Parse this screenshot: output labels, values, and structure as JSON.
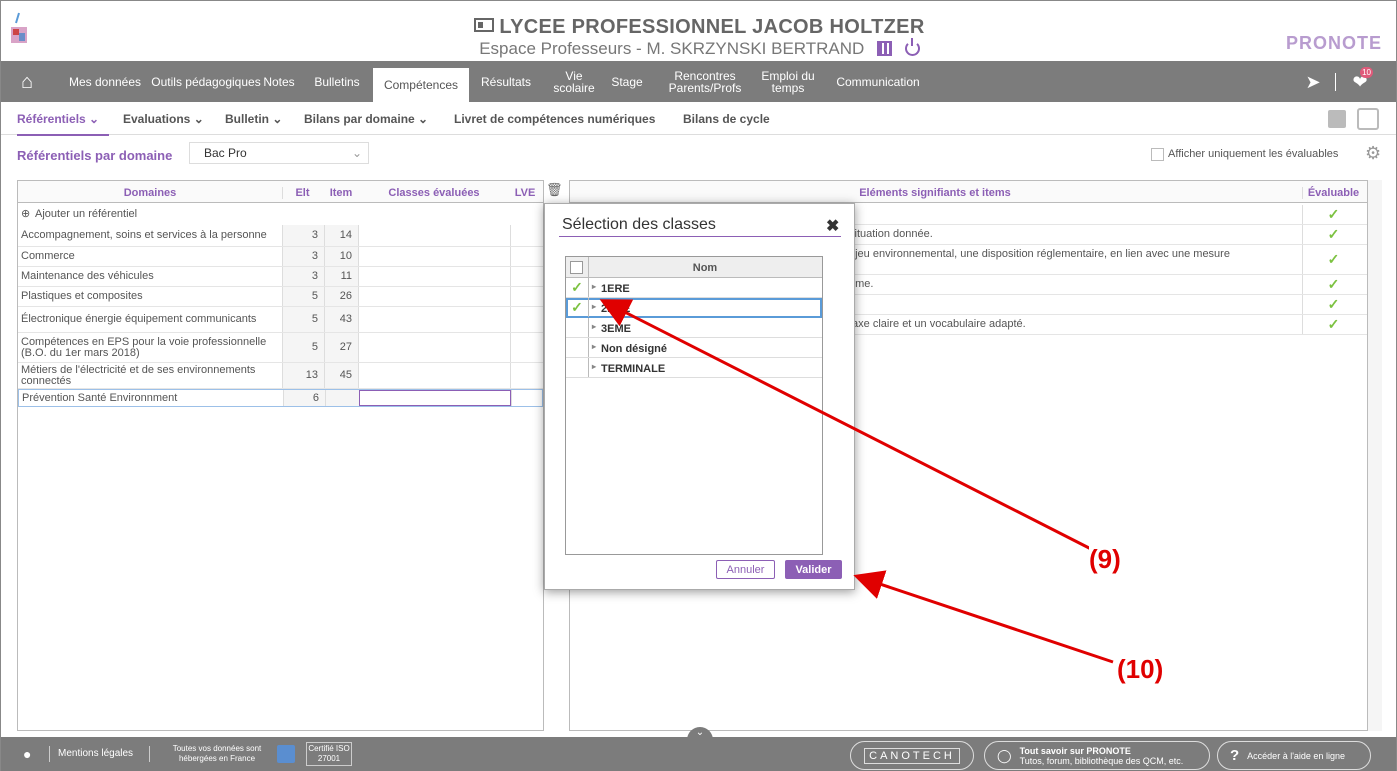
{
  "header": {
    "school": "LYCEE PROFESSIONNEL JACOB HOLTZER",
    "espace": "Espace Professeurs - M. SKRZYNSKI BERTRAND",
    "brand": "PRONOTE",
    "notif_count": "10"
  },
  "nav": [
    {
      "label": "Mes données"
    },
    {
      "label": "Outils pédagogiques"
    },
    {
      "label": "Notes"
    },
    {
      "label": "Bulletins"
    },
    {
      "label": "Compétences"
    },
    {
      "label": "Résultats"
    },
    {
      "label": "Vie scolaire"
    },
    {
      "label": "Stage"
    },
    {
      "label": "Rencontres Parents/Profs"
    },
    {
      "label": "Emploi du temps"
    },
    {
      "label": "Communication"
    }
  ],
  "subnav": {
    "referentiels": "Référentiels",
    "evaluations": "Evaluations",
    "bulletin": "Bulletin",
    "bilans_domaine": "Bilans par domaine",
    "livret": "Livret de compétences numériques",
    "bilans_cycle": "Bilans de cycle"
  },
  "filter": {
    "label": "Référentiels par domaine",
    "select_value": "Bac Pro",
    "evaluables_label": "Afficher uniquement les évaluables"
  },
  "left_table": {
    "headers": {
      "domaines": "Domaines",
      "elt": "Elt",
      "item": "Item",
      "classes": "Classes évaluées",
      "lve": "LVE"
    },
    "add_label": "Ajouter un référentiel",
    "rows": [
      {
        "domaine": "Accompagnement, soins et services à la personne",
        "elt": "3",
        "item": "14"
      },
      {
        "domaine": "Commerce",
        "elt": "3",
        "item": "10"
      },
      {
        "domaine": "Maintenance des véhicules",
        "elt": "3",
        "item": "11"
      },
      {
        "domaine": "Plastiques et composites",
        "elt": "5",
        "item": "26"
      },
      {
        "domaine": "Électronique énergie équipement communicants",
        "elt": "5",
        "item": "43"
      },
      {
        "domaine": "Compétences en EPS pour la voie professionnelle (B.O. du 1er mars 2018)",
        "elt": "5",
        "item": "27"
      },
      {
        "domaine": "Métiers de l'électricité et de ses environnements connectés",
        "elt": "13",
        "item": "45"
      },
      {
        "domaine": "Prévention Santé Environnment",
        "elt": "6",
        "item": ""
      }
    ]
  },
  "right_table": {
    "headers": {
      "elements": "Eléments signifiants et items",
      "evaluable": "Évaluable"
    },
    "rows": [
      {
        "text": ""
      },
      {
        "text": "situation donnée."
      },
      {
        "text": "njeu environnemental, une disposition réglementaire, en lien avec une mesure"
      },
      {
        "text": "ème."
      },
      {
        "text": ""
      },
      {
        "text": "taxe claire et un vocabulaire adapté."
      }
    ]
  },
  "modal": {
    "title": "Sélection des classes",
    "col_header": "Nom",
    "rows": [
      {
        "name": "1ERE",
        "checked": true
      },
      {
        "name": "2NDE",
        "checked": true
      },
      {
        "name": "3EME",
        "checked": false
      },
      {
        "name": "Non désigné",
        "checked": false
      },
      {
        "name": "TERMINALE",
        "checked": false
      }
    ],
    "cancel": "Annuler",
    "validate": "Valider"
  },
  "annotations": {
    "a9": "(9)",
    "a10": "(10)"
  },
  "footer": {
    "mentions": "Mentions légales",
    "hosted": "Toutes vos données sont hébergées en France",
    "certif": "Certifié ISO 27001",
    "canotech": "CANOTECH",
    "tout_savoir": "Tout savoir sur PRONOTE",
    "tout_savoir_sub": "Tutos, forum, bibliothèque des QCM, etc.",
    "aide": "Accéder à l'aide en ligne"
  },
  "colors": {
    "accent": "#8c5fb5",
    "nav": "#7c7c7c",
    "check": "#7cc241",
    "annotation": "#e00000"
  }
}
